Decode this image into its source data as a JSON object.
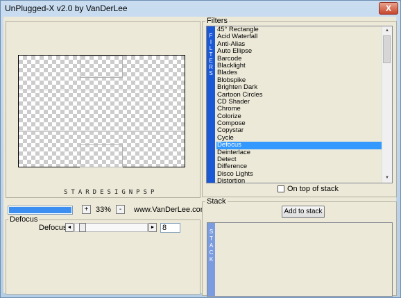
{
  "window": {
    "title": "UnPlugged-X v2.0 by VanDerLee",
    "close_label": "X"
  },
  "preview": {
    "logo_text": "STARDESIGNPSP"
  },
  "controls": {
    "progress_fraction": 1.0,
    "zoom_plus": "+",
    "zoom_value": "33%",
    "zoom_minus": "-",
    "url": "www.VanDerLee.com"
  },
  "defocus_group": {
    "label": "Defocus",
    "param_label": "Defocus",
    "left_arrow": "◄",
    "right_arrow": "►",
    "value": "8",
    "slider_fraction": 0.05
  },
  "filters": {
    "group_label": "Filters",
    "vertical_label": [
      "F",
      "I",
      "L",
      "T",
      "E",
      "R",
      "S"
    ],
    "items": [
      "45° Rectangle",
      "Acid Waterfall",
      "Anti-Alias",
      "Auto Ellipse",
      "Barcode",
      "Blacklight",
      "Blades",
      "Blobspike",
      "Brighten Dark",
      "Cartoon Circles",
      "CD Shader",
      "Chrome",
      "Colorize",
      "Compose",
      "Copystar",
      "Cycle",
      "Defocus",
      "Deinterlace",
      "Detect",
      "Difference",
      "Disco Lights",
      "Distortion"
    ],
    "selected_index": 16,
    "on_top_label": "On top of stack"
  },
  "stack": {
    "group_label": "Stack",
    "add_button": "Add to stack",
    "vertical_label": [
      "S",
      "T",
      "A",
      "C",
      "K"
    ]
  },
  "colors": {
    "filter_bar": "#1b58d6",
    "stack_bar": "#7c9ce0",
    "selection": "#3399ff",
    "progress": "#3c8ff0"
  },
  "icons": {
    "scroll_up": "triangle-up",
    "scroll_down": "triangle-down"
  }
}
